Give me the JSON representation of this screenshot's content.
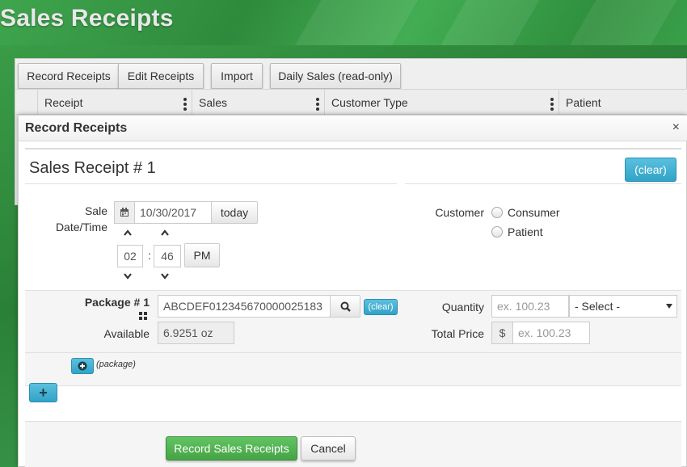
{
  "page": {
    "title": "Sales Receipts"
  },
  "toolbar": {
    "record_receipts": "Record Receipts",
    "edit_receipts": "Edit Receipts",
    "import": "Import",
    "daily_sales": "Daily Sales (read-only)"
  },
  "grid": {
    "columns": [
      "Receipt",
      "Sales",
      "Customer Type",
      "Patient"
    ]
  },
  "dialog": {
    "title": "Record Receipts",
    "close_glyph": "×",
    "receipt_title": "Sales Receipt # 1",
    "clear_label": "(clear)",
    "sale_datetime_label_line1": "Sale",
    "sale_datetime_label_line2": "Date/Time",
    "date_value": "10/30/2017",
    "today_label": "today",
    "hour_value": "02",
    "time_separator": ":",
    "minute_value": "46",
    "ampm_label": "PM",
    "chevron_up": "^",
    "chevron_down": "v",
    "customer_label": "Customer",
    "customer_options": [
      "Consumer",
      "Patient"
    ],
    "package_label": "Package # 1",
    "package_value": "ABCDEF012345670000025183",
    "package_clear_label": "(clear)",
    "available_label": "Available",
    "available_value": "6.9251 oz",
    "quantity_label": "Quantity",
    "quantity_placeholder": "ex. 100.23",
    "unit_select_value": "- Select -",
    "total_price_label": "Total Price",
    "currency_symbol": "$",
    "total_price_placeholder": "ex. 100.23",
    "add_package_label": "(package)",
    "add_receipt_glyph": "+",
    "submit_label": "Record Sales Receipts",
    "cancel_label": "Cancel"
  },
  "colors": {
    "header_green": "#3fa54e",
    "info_blue": "#5bc0de",
    "success_green": "#5cb85c"
  },
  "icons": [
    "calendar-icon",
    "search-icon",
    "barcode-grid-icon",
    "plus-circle-icon",
    "plus-icon",
    "close-icon",
    "chevron-up-icon",
    "chevron-down-icon",
    "caret-down-icon",
    "kebab-menu-icon"
  ]
}
